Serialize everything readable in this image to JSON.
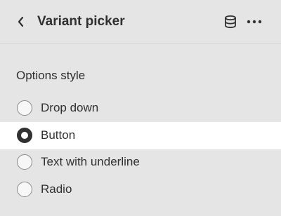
{
  "header": {
    "title": "Variant picker",
    "back_icon": "chevron-left-icon",
    "data_icon": "database-icon",
    "more_icon": "more-horizontal-icon"
  },
  "options_section": {
    "label": "Options style",
    "selected": "Button",
    "options": [
      {
        "label": "Drop down",
        "selected": false
      },
      {
        "label": "Button",
        "selected": true
      },
      {
        "label": "Text with underline",
        "selected": false
      },
      {
        "label": "Radio",
        "selected": false
      }
    ]
  },
  "colors": {
    "background": "#e5e5e5",
    "selected_row": "#ffffff",
    "text": "#303030"
  }
}
